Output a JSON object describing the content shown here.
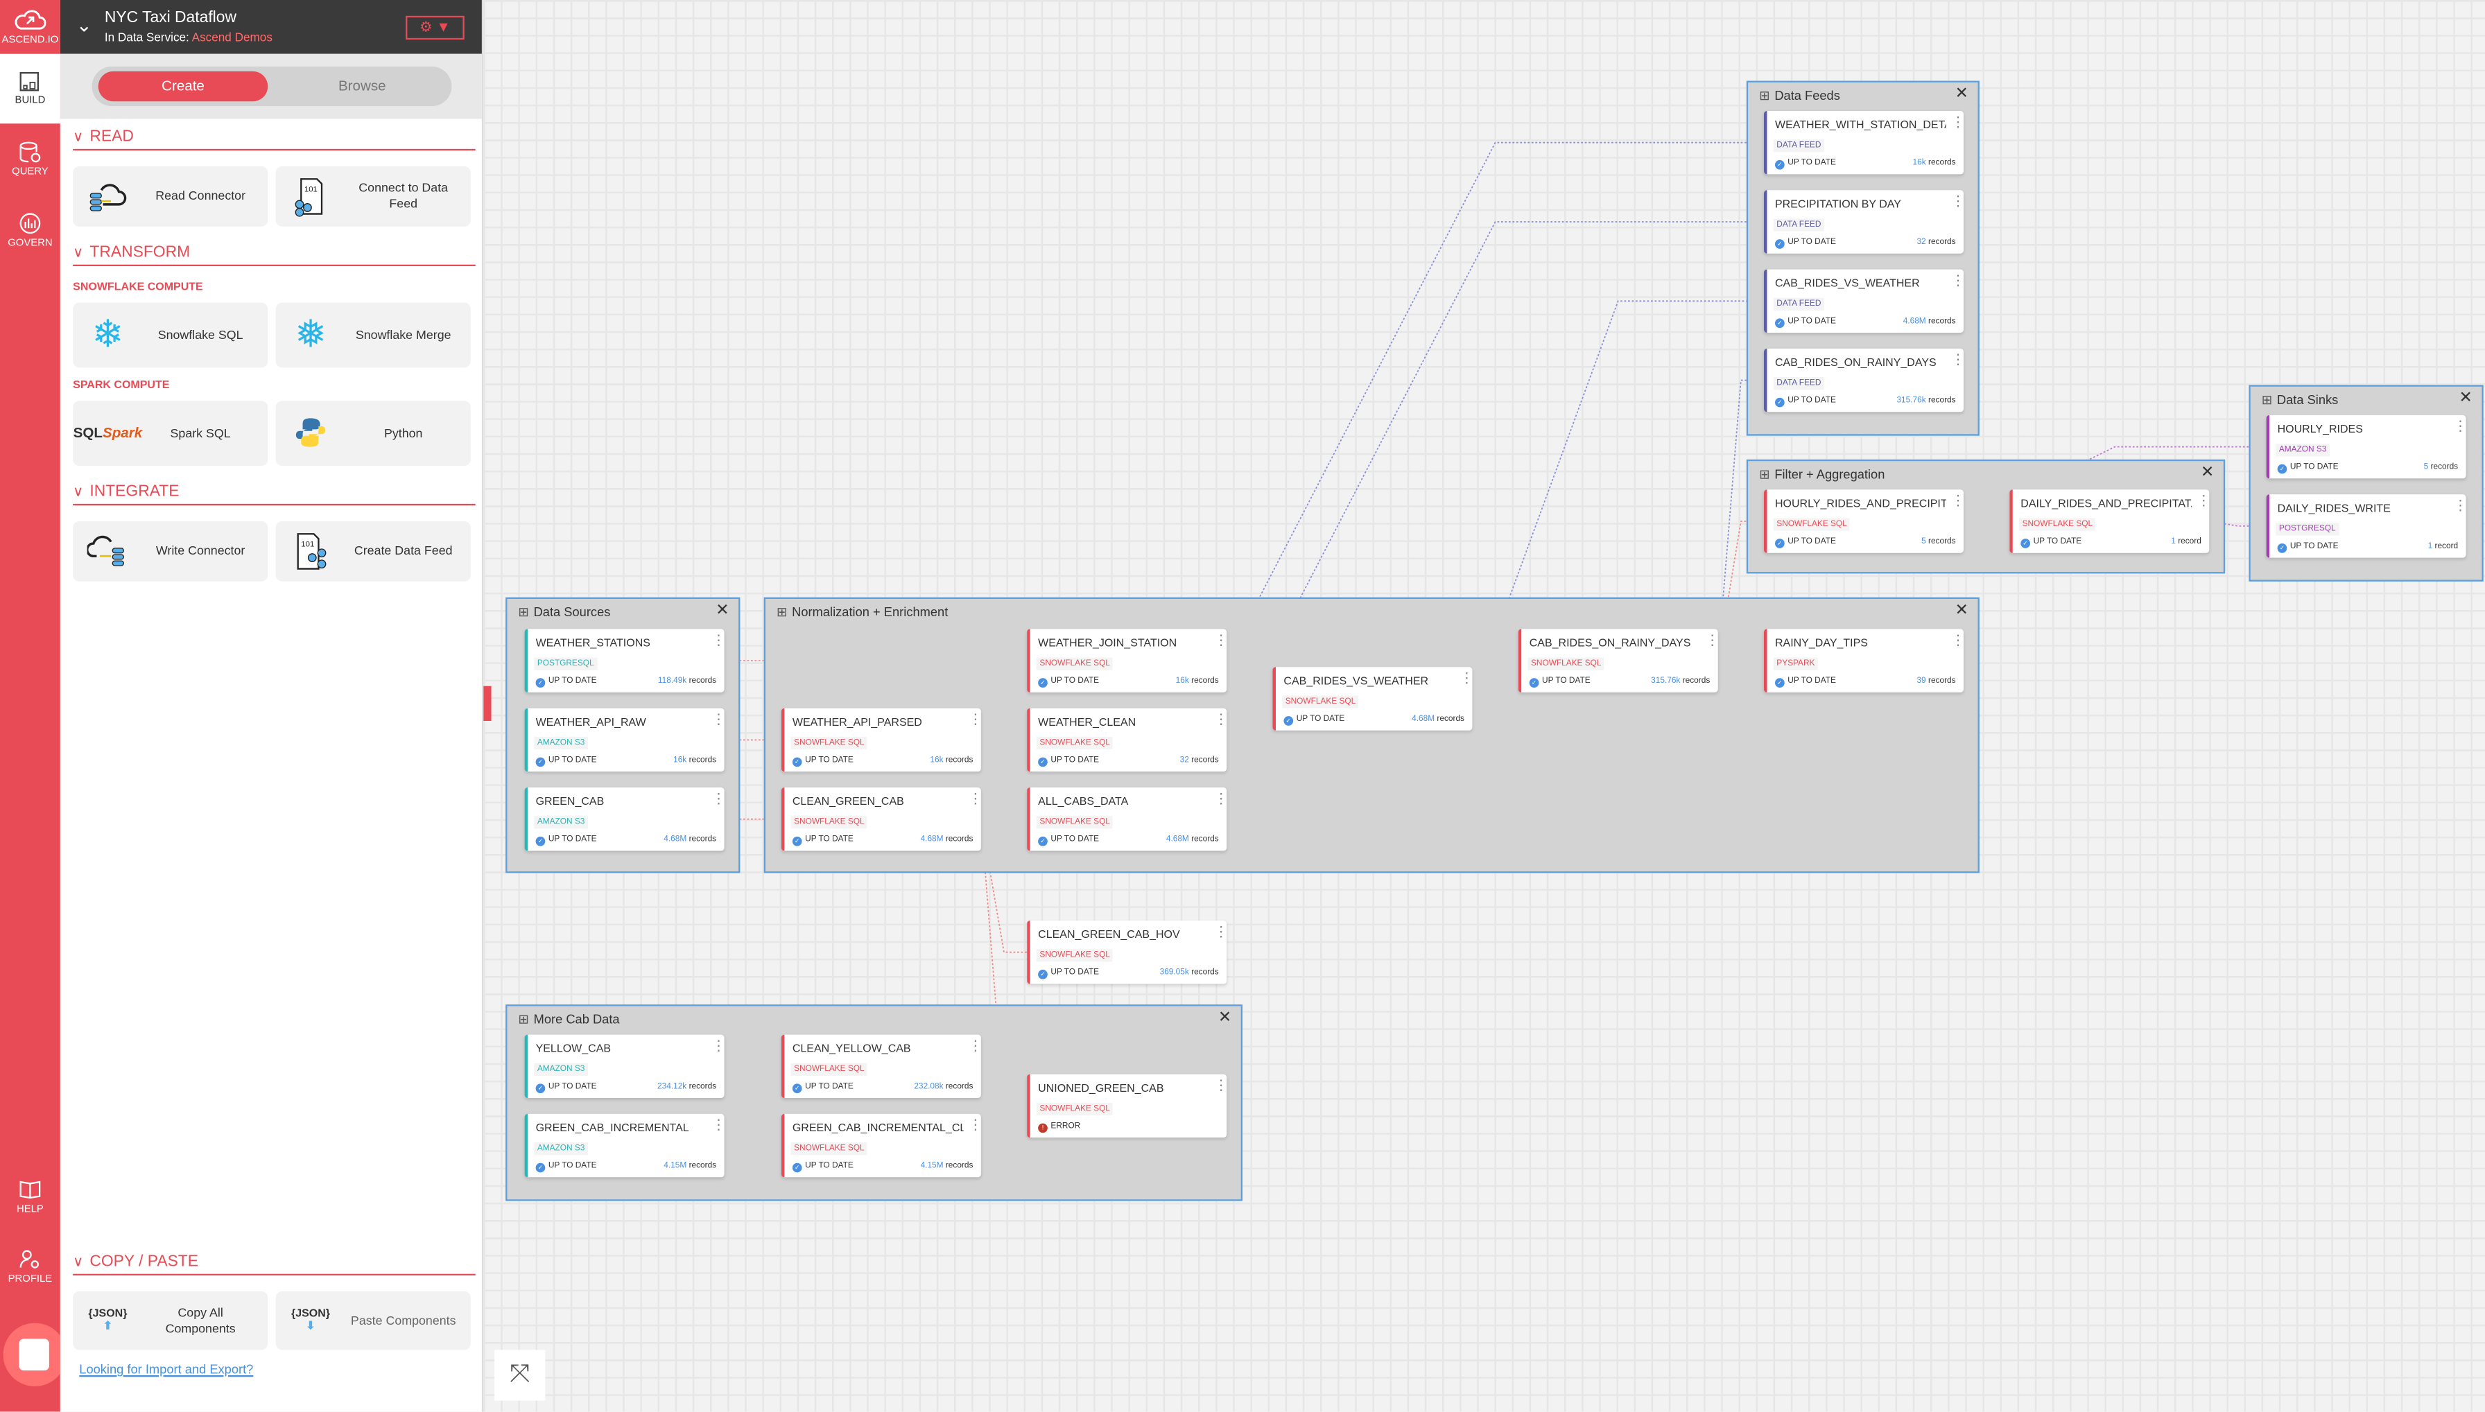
{
  "rail": {
    "logo": "ASCEND.IO",
    "items": [
      "BUILD",
      "QUERY",
      "GOVERN"
    ],
    "bottom": [
      "HELP",
      "PROFILE"
    ]
  },
  "header": {
    "title": "NYC Taxi Dataflow",
    "service_label": "In Data Service:",
    "service_name": "Ascend Demos"
  },
  "toggle": {
    "create": "Create",
    "browse": "Browse"
  },
  "sections": {
    "read": {
      "title": "READ",
      "tiles": [
        "Read Connector",
        "Connect to Data Feed"
      ]
    },
    "transform": {
      "title": "TRANSFORM",
      "snowflake": "SNOWFLAKE COMPUTE",
      "snow_tiles": [
        "Snowflake SQL",
        "Snowflake Merge"
      ],
      "spark": "SPARK COMPUTE",
      "spark_tiles": [
        "Spark SQL",
        "Python"
      ]
    },
    "integrate": {
      "title": "INTEGRATE",
      "tiles": [
        "Write Connector",
        "Create Data Feed"
      ]
    },
    "copy": {
      "title": "COPY / PASTE",
      "tiles": [
        "Copy All Components",
        "Paste Components"
      ]
    }
  },
  "import_link": "Looking for Import and Export?",
  "colors": {
    "accent": "#e84b55",
    "source": "#2bb5b5",
    "transform": "#e84b55",
    "feed": "#5b5ea6",
    "sink": "#a040b0",
    "count": "#4a90e2"
  },
  "groups": [
    {
      "id": "sources",
      "title": "Data Sources",
      "nodes": [
        {
          "id": "ws",
          "name": "WEATHER_STATIONS",
          "type": "POSTGRESQL",
          "kind": "source",
          "status": "UP TO DATE",
          "count": "118.49k",
          "unit": "records"
        },
        {
          "id": "war",
          "name": "WEATHER_API_RAW",
          "type": "AMAZON S3",
          "kind": "source",
          "status": "UP TO DATE",
          "count": "16k",
          "unit": "records"
        },
        {
          "id": "gc",
          "name": "GREEN_CAB",
          "type": "AMAZON S3",
          "kind": "source",
          "status": "UP TO DATE",
          "count": "4.68M",
          "unit": "records"
        }
      ]
    },
    {
      "id": "norm",
      "title": "Normalization + Enrichment",
      "nodes": [
        {
          "id": "wap",
          "name": "WEATHER_API_PARSED",
          "type": "SNOWFLAKE SQL",
          "kind": "transform",
          "status": "UP TO DATE",
          "count": "16k",
          "unit": "records"
        },
        {
          "id": "cgc",
          "name": "CLEAN_GREEN_CAB",
          "type": "SNOWFLAKE SQL",
          "kind": "transform",
          "status": "UP TO DATE",
          "count": "4.68M",
          "unit": "records"
        },
        {
          "id": "wjs",
          "name": "WEATHER_JOIN_STATION",
          "type": "SNOWFLAKE SQL",
          "kind": "transform",
          "status": "UP TO DATE",
          "count": "16k",
          "unit": "records"
        },
        {
          "id": "wc",
          "name": "WEATHER_CLEAN",
          "type": "SNOWFLAKE SQL",
          "kind": "transform",
          "status": "UP TO DATE",
          "count": "32",
          "unit": "records"
        },
        {
          "id": "acd",
          "name": "ALL_CABS_DATA",
          "type": "SNOWFLAKE SQL",
          "kind": "transform",
          "status": "UP TO DATE",
          "count": "4.68M",
          "unit": "records"
        },
        {
          "id": "crw",
          "name": "CAB_RIDES_VS_WEATHER",
          "type": "SNOWFLAKE SQL",
          "kind": "transform",
          "status": "UP TO DATE",
          "count": "4.68M",
          "unit": "records"
        },
        {
          "id": "crr",
          "name": "CAB_RIDES_ON_RAINY_DAYS",
          "type": "SNOWFLAKE SQL",
          "kind": "transform",
          "status": "UP TO DATE",
          "count": "315.76k",
          "unit": "records"
        },
        {
          "id": "rdt",
          "name": "RAINY_DAY_TIPS",
          "type": "PYSPARK",
          "kind": "transform",
          "status": "UP TO DATE",
          "count": "39",
          "unit": "records"
        }
      ]
    },
    {
      "id": "feeds",
      "title": "Data Feeds",
      "nodes": [
        {
          "id": "f1",
          "name": "WEATHER_WITH_STATION_DETAI...",
          "type": "DATA FEED",
          "kind": "feed",
          "status": "UP TO DATE",
          "count": "16k",
          "unit": "records"
        },
        {
          "id": "f2",
          "name": "PRECIPITATION BY DAY",
          "type": "DATA FEED",
          "kind": "feed",
          "status": "UP TO DATE",
          "count": "32",
          "unit": "records"
        },
        {
          "id": "f3",
          "name": "CAB_RIDES_VS_WEATHER",
          "type": "DATA FEED",
          "kind": "feed",
          "status": "UP TO DATE",
          "count": "4.68M",
          "unit": "records"
        },
        {
          "id": "f4",
          "name": "CAB_RIDES_ON_RAINY_DAYS",
          "type": "DATA FEED",
          "kind": "feed",
          "status": "UP TO DATE",
          "count": "315.76k",
          "unit": "records"
        }
      ]
    },
    {
      "id": "sinks",
      "title": "Data Sinks",
      "nodes": [
        {
          "id": "hr",
          "name": "HOURLY_RIDES",
          "type": "AMAZON S3",
          "kind": "sink",
          "status": "UP TO DATE",
          "count": "5",
          "unit": "records"
        },
        {
          "id": "drw",
          "name": "DAILY_RIDES_WRITE",
          "type": "POSTGRESQL",
          "kind": "sink",
          "status": "UP TO DATE",
          "count": "1",
          "unit": "record"
        }
      ]
    },
    {
      "id": "filter",
      "title": "Filter + Aggregation",
      "nodes": [
        {
          "id": "hrp",
          "name": "HOURLY_RIDES_AND_PRECIPITA...",
          "type": "SNOWFLAKE SQL",
          "kind": "transform",
          "status": "UP TO DATE",
          "count": "5",
          "unit": "records"
        },
        {
          "id": "drp",
          "name": "DAILY_RIDES_AND_PRECIPITAT...",
          "type": "SNOWFLAKE SQL",
          "kind": "transform",
          "status": "UP TO DATE",
          "count": "1",
          "unit": "record"
        }
      ]
    },
    {
      "id": "more",
      "title": "More Cab Data",
      "nodes": [
        {
          "id": "yc",
          "name": "YELLOW_CAB",
          "type": "AMAZON S3",
          "kind": "source",
          "status": "UP TO DATE",
          "count": "234.12k",
          "unit": "records"
        },
        {
          "id": "gci",
          "name": "GREEN_CAB_INCREMENTAL",
          "type": "AMAZON S3",
          "kind": "source",
          "status": "UP TO DATE",
          "count": "4.15M",
          "unit": "records"
        },
        {
          "id": "cyc",
          "name": "CLEAN_YELLOW_CAB",
          "type": "SNOWFLAKE SQL",
          "kind": "transform",
          "status": "UP TO DATE",
          "count": "232.08k",
          "unit": "records"
        },
        {
          "id": "gcic",
          "name": "GREEN_CAB_INCREMENTAL_CLEA...",
          "type": "SNOWFLAKE SQL",
          "kind": "transform",
          "status": "UP TO DATE",
          "count": "4.15M",
          "unit": "records"
        },
        {
          "id": "ugc",
          "name": "UNIONED_GREEN_CAB",
          "type": "SNOWFLAKE SQL",
          "kind": "transform",
          "status": "ERROR",
          "count": "",
          "unit": ""
        }
      ]
    }
  ],
  "free_nodes": [
    {
      "id": "hov",
      "name": "CLEAN_GREEN_CAB_HOV",
      "type": "SNOWFLAKE SQL",
      "kind": "transform",
      "status": "UP TO DATE",
      "count": "369.05k",
      "unit": "records"
    }
  ]
}
